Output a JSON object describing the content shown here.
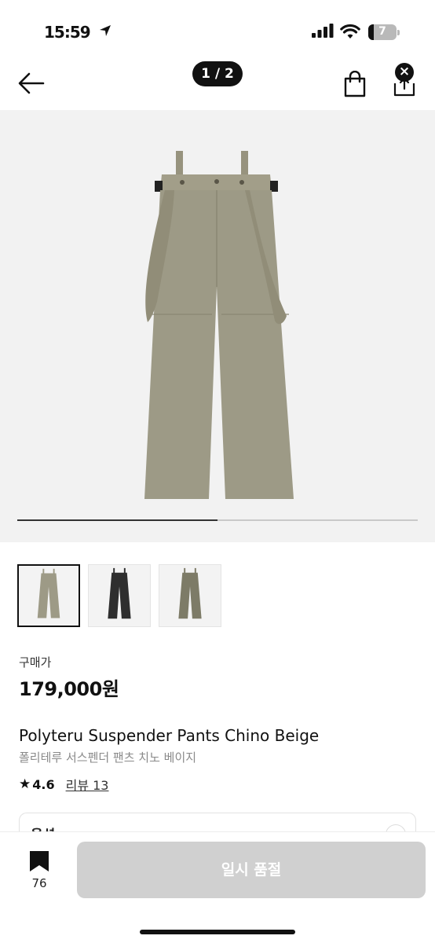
{
  "status_bar": {
    "time": "15:59",
    "battery_level": "7",
    "battery_fraction": 0.2
  },
  "header": {
    "page_indicator": "1 / 2",
    "close_badge": "×"
  },
  "gallery": {
    "position_fraction": 0.5,
    "thumbnail_count": 3,
    "selected_thumbnail": 0
  },
  "product": {
    "price_label": "구매가",
    "price": "179,000원",
    "name": "Polyteru Suspender Pants Chino Beige",
    "name_ko": "폴리테루 서스펜더 팬츠 치노 베이지",
    "rating_star": "★",
    "rating": "4.6",
    "review_link": "리뷰 13"
  },
  "options": {
    "label": "옵션"
  },
  "bottom_bar": {
    "bookmark_count": "76",
    "soldout_label": "일시 품절"
  },
  "colors": {
    "accent": "#111111",
    "disabled_button": "#d0d0d0",
    "pants_beige": "#9d9a86",
    "pants_black": "#2e2e2e",
    "pants_olive": "#7d7b67",
    "image_bg": "#f2f2f2"
  },
  "icons": {
    "back": "arrow-left-icon",
    "cart": "shopping-bag-icon",
    "share": "share-icon",
    "close": "close-icon",
    "bookmark": "bookmark-icon",
    "star": "star-icon"
  }
}
